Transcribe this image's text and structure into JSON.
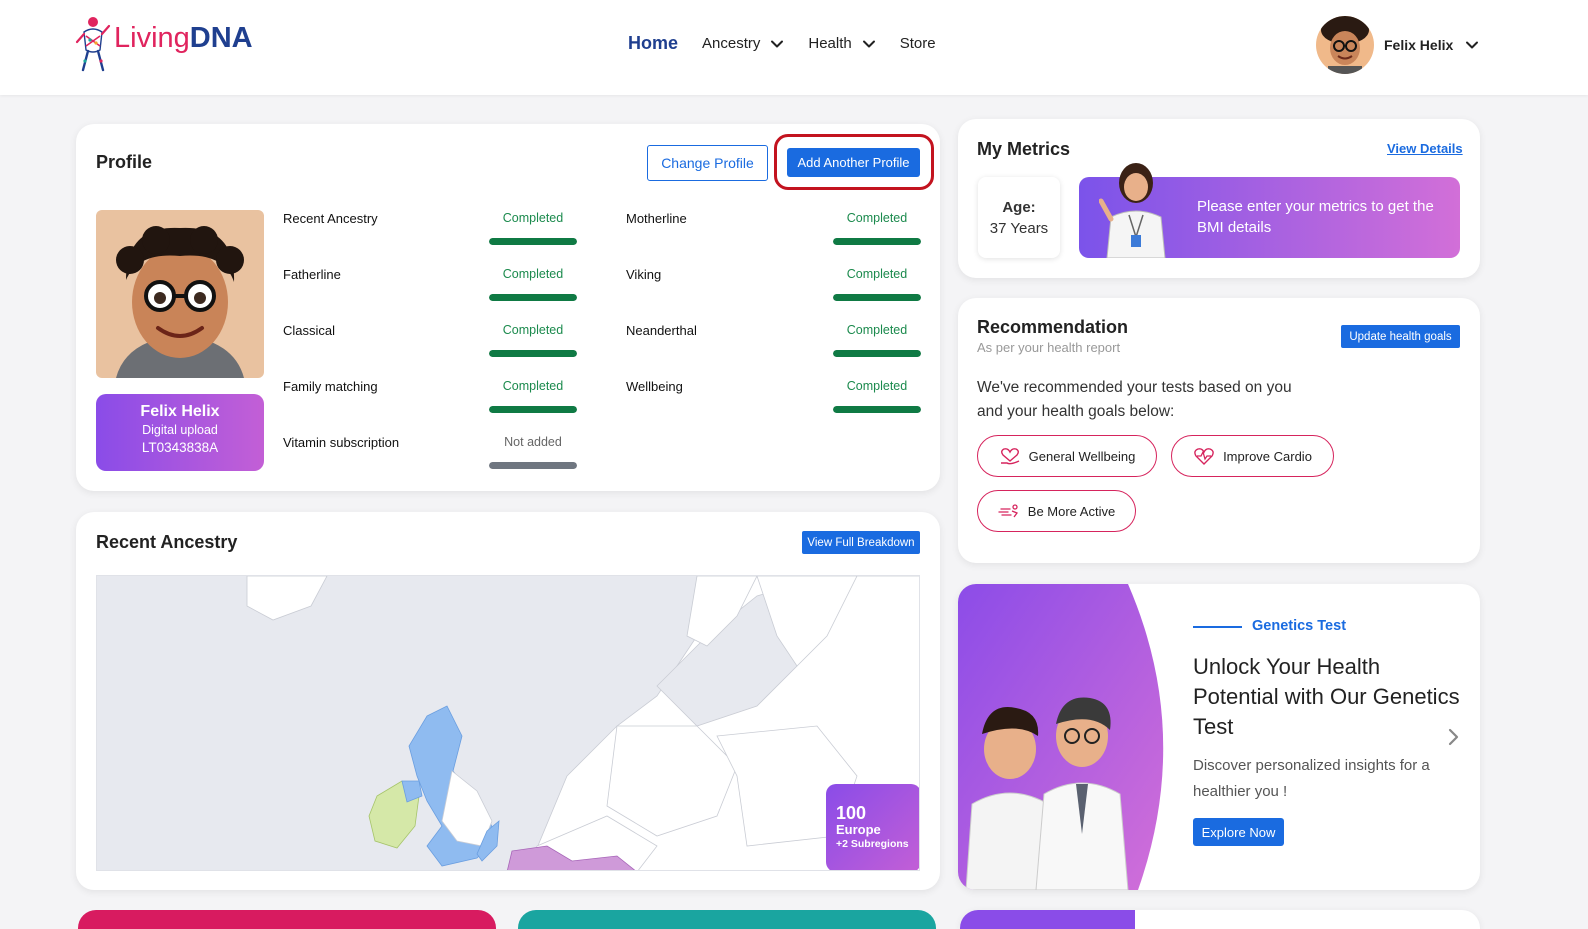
{
  "header": {
    "logo": {
      "living": "Living",
      "dna": "DNA"
    },
    "nav": [
      {
        "label": "Home",
        "active": true,
        "dropdown": false
      },
      {
        "label": "Ancestry",
        "active": false,
        "dropdown": true
      },
      {
        "label": "Health",
        "active": false,
        "dropdown": true
      },
      {
        "label": "Store",
        "active": false,
        "dropdown": false
      }
    ],
    "user_name": "Felix Helix"
  },
  "profile": {
    "title": "Profile",
    "change_profile": "Change Profile",
    "add_profile": "Add Another Profile",
    "badge": {
      "name": "Felix Helix",
      "source": "Digital upload",
      "code": "LT0343838A"
    },
    "tests": [
      {
        "label": "Recent Ancestry",
        "status": "Completed",
        "progress": 1
      },
      {
        "label": "Motherline",
        "status": "Completed",
        "progress": 1
      },
      {
        "label": "Fatherline",
        "status": "Completed",
        "progress": 1
      },
      {
        "label": "Viking",
        "status": "Completed",
        "progress": 1
      },
      {
        "label": "Classical",
        "status": "Completed",
        "progress": 1
      },
      {
        "label": "Neanderthal",
        "status": "Completed",
        "progress": 1
      },
      {
        "label": "Family matching",
        "status": "Completed",
        "progress": 1
      },
      {
        "label": "Wellbeing",
        "status": "Completed",
        "progress": 1
      },
      {
        "label": "Vitamin subscription",
        "status": "Not added",
        "progress": 1
      }
    ]
  },
  "ancestry": {
    "title": "Recent Ancestry",
    "button": "View Full Breakdown",
    "badge": {
      "value": "100",
      "region": "Europe",
      "subregions": "+2 Subregions"
    }
  },
  "metrics": {
    "title": "My Metrics",
    "view_details": "View Details",
    "age_label": "Age:",
    "age_value": "37 Years",
    "bmi_prompt": "Please enter your metrics to get the BMI details"
  },
  "recommendation": {
    "title": "Recommendation",
    "subtitle": "As per your health report",
    "button": "Update health goals",
    "body": "We've recommended your tests based on you and your health goals below:",
    "goals": [
      {
        "label": "General Wellbeing",
        "icon": "heart-hand-icon"
      },
      {
        "label": "Improve Cardio",
        "icon": "heartbeat-icon"
      },
      {
        "label": "Be More Active",
        "icon": "running-icon"
      }
    ]
  },
  "genetics": {
    "tag": "Genetics Test",
    "title": "Unlock Your Health Potential with Our Genetics Test",
    "desc": "Discover personalized insights for a healthier you !",
    "button": "Explore Now"
  },
  "colors": {
    "brand_blue": "#1a6be0",
    "brand_pink": "#e0245e",
    "completed_green": "#0f7a44",
    "highlight_red": "#c3131f",
    "gradient_start": "#8a4ce8",
    "gradient_end": "#c35fd6"
  }
}
